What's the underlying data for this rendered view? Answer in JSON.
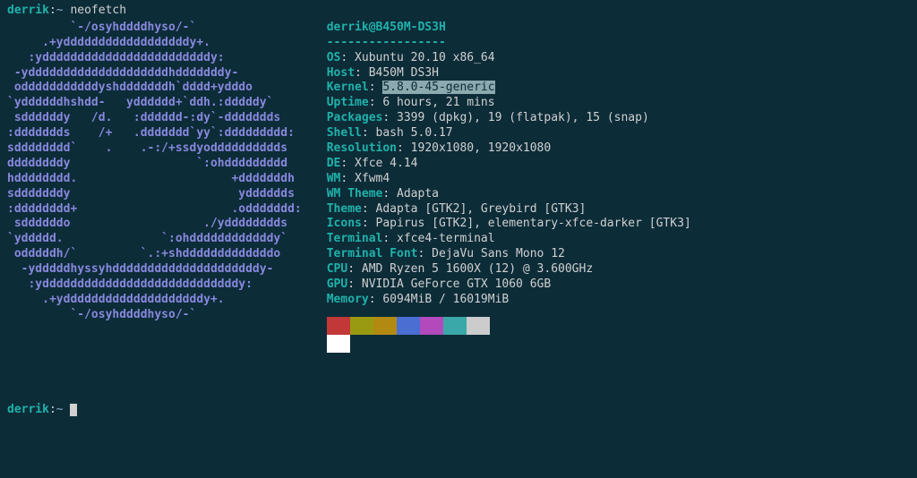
{
  "prompt": {
    "user": "derrik",
    "sep": ":",
    "path": "~",
    "command": "neofetch"
  },
  "ascii_logo": "         `-/osyhddddhyso/-`        \n     .+yddddddddddddddddddy+.      \n   :yddddddddddddddddddddddddy:    \n -yddddddddddddddddddddhdddddddy-  \n odddddddddddyshdddddddh`dddd+ydddo\n`yddddddhshdd-   ydddddd+`ddh.:dddddy`\n sddddddy   /d.   :dddddd-:dy`-ddddddds\n:ddddddds    /+   .ddddddd`yy`:ddddddddd:\nsdddddddd`    .    .-:/+ssdyodddddddddds\nddddddddy                  `:ohddddddddd\nhdddddddd.                      +dddddddh\nsdddddddy                        ydddddds\n:dddddddd+                      .oddddddd:\n sddddddo                   ./ydddddddds \n`yddddd.              `:ohddddddddddddy` \n odddddh/`         `.:+shdddddddddddddo  \n  -ydddddhyssyhdddddddddddddddddddddy-   \n   :yddddddddddddddddddddddddddddy:     \n     .+yddddddddddddddddddddy+.        \n         `-/osyhddddhyso/-`            ",
  "neofetch": {
    "user_host": "derrik@B450M-DS3H",
    "separator": "-----------------",
    "rows": [
      {
        "label": "OS",
        "value": "Xubuntu 20.10 x86_64"
      },
      {
        "label": "Host",
        "value": "B450M DS3H"
      },
      {
        "label": "Kernel",
        "value": "5.8.0-45-generic",
        "highlighted": true
      },
      {
        "label": "Uptime",
        "value": "6 hours, 21 mins"
      },
      {
        "label": "Packages",
        "value": "3399 (dpkg), 19 (flatpak), 15 (snap)"
      },
      {
        "label": "Shell",
        "value": "bash 5.0.17"
      },
      {
        "label": "Resolution",
        "value": "1920x1080, 1920x1080"
      },
      {
        "label": "DE",
        "value": "Xfce 4.14"
      },
      {
        "label": "WM",
        "value": "Xfwm4"
      },
      {
        "label": "WM Theme",
        "value": "Adapta"
      },
      {
        "label": "Theme",
        "value": "Adapta [GTK2], Greybird [GTK3]"
      },
      {
        "label": "Icons",
        "value": "Papirus [GTK2], elementary-xfce-darker [GTK3]"
      },
      {
        "label": "Terminal",
        "value": "xfce4-terminal"
      },
      {
        "label": "Terminal Font",
        "value": "DejaVu Sans Mono 12"
      },
      {
        "label": "CPU",
        "value": "AMD Ryzen 5 1600X (12) @ 3.600GHz"
      },
      {
        "label": "GPU",
        "value": "NVIDIA GeForce GTX 1060 6GB"
      },
      {
        "label": "Memory",
        "value": "6094MiB / 16019MiB"
      }
    ],
    "colors_row1": [
      "#c23838",
      "#9a9a12",
      "#b28a12",
      "#4a6ed2",
      "#b24abc",
      "#3aa8a8",
      "#cccccc"
    ],
    "colors_row2": [
      "#ffffff"
    ]
  }
}
